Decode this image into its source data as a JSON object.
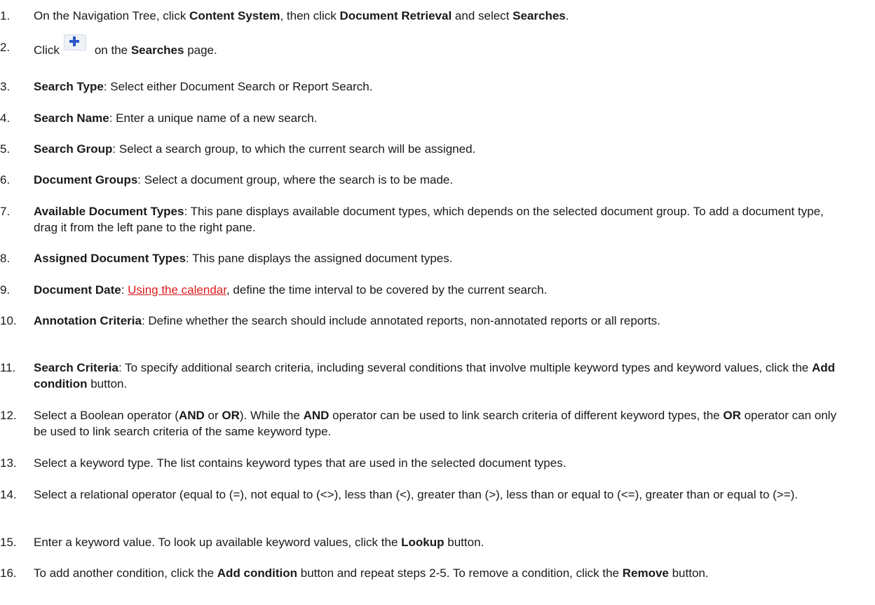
{
  "steps": [
    {
      "num": "1.",
      "segments": [
        {
          "t": "On the Navigation Tree, click "
        },
        {
          "b": "Content System"
        },
        {
          "t": ", then click "
        },
        {
          "b": "Document Retrieval"
        },
        {
          "t": " and select "
        },
        {
          "b": "Searches"
        },
        {
          "t": "."
        }
      ]
    },
    {
      "num": "2.",
      "segments": [
        {
          "t": "Click"
        },
        {
          "icon": "plus-add-icon"
        },
        {
          "t": "on the "
        },
        {
          "b": "Searches"
        },
        {
          "t": " page."
        }
      ]
    },
    {
      "num": "3.",
      "segments": [
        {
          "b": "Search Type"
        },
        {
          "t": ": Select either Document Search or Report Search."
        }
      ]
    },
    {
      "num": "4.",
      "segments": [
        {
          "b": "Search Name"
        },
        {
          "t": ": Enter a unique name of a new search."
        }
      ]
    },
    {
      "num": "5.",
      "segments": [
        {
          "b": "Search Group"
        },
        {
          "t": ": Select a search group, to which the current search will be assigned."
        }
      ]
    },
    {
      "num": "6.",
      "segments": [
        {
          "b": "Document Groups"
        },
        {
          "t": ": Select a document group, where the search is to be made."
        }
      ]
    },
    {
      "num": "7.",
      "segments": [
        {
          "b": "Available Document Types"
        },
        {
          "t": ": This pane displays available document types, which depends on the selected document group. To add a document type, drag it from the left pane to the right pane."
        }
      ]
    },
    {
      "num": "8.",
      "segments": [
        {
          "b": "Assigned Document Types"
        },
        {
          "t": ": This pane displays the assigned document types."
        }
      ]
    },
    {
      "num": "9.",
      "segments": [
        {
          "b": "Document Date"
        },
        {
          "t": ": "
        },
        {
          "link": "Using the calendar"
        },
        {
          "t": ", define the time interval to be covered by the current search."
        }
      ]
    },
    {
      "num": "10.",
      "segments": [
        {
          "b": "Annotation Criteria"
        },
        {
          "t": ": Define whether the search should include annotated reports, non-annotated reports or all reports."
        }
      ]
    },
    {
      "num": "11.",
      "segments": [
        {
          "b": "Search Criteria"
        },
        {
          "t": ": To specify additional search criteria, including several conditions that involve multiple keyword types and keyword values, click the "
        },
        {
          "b": "Add condition"
        },
        {
          "t": " button."
        }
      ]
    },
    {
      "num": "12.",
      "segments": [
        {
          "t": "Select a Boolean operator ("
        },
        {
          "b": "AND"
        },
        {
          "t": " or "
        },
        {
          "b": "OR"
        },
        {
          "t": "). While the "
        },
        {
          "b": "AND"
        },
        {
          "t": " operator can be used to link search criteria of different keyword types, the "
        },
        {
          "b": "OR"
        },
        {
          "t": " operator can only be used to link search criteria of the same keyword type."
        }
      ]
    },
    {
      "num": "13.",
      "segments": [
        {
          "t": "Select a keyword type. The list contains keyword types that are used in the selected document types."
        }
      ]
    },
    {
      "num": "14.",
      "segments": [
        {
          "t": "Select a relational operator (equal to (=), not equal to (<>), less than (<), greater than (>), less than or equal to (<=), greater than or equal to (>=)."
        }
      ]
    },
    {
      "num": "15.",
      "segments": [
        {
          "t": "Enter a keyword value. To look up available keyword values, click the "
        },
        {
          "b": "Lookup"
        },
        {
          "t": " button."
        }
      ]
    },
    {
      "num": "16.",
      "segments": [
        {
          "t": "To add another condition, click the "
        },
        {
          "b": "Add condition"
        },
        {
          "t": " button and repeat steps 2-5. To remove a condition, click the "
        },
        {
          "b": "Remove"
        },
        {
          "t": " button."
        }
      ]
    }
  ]
}
